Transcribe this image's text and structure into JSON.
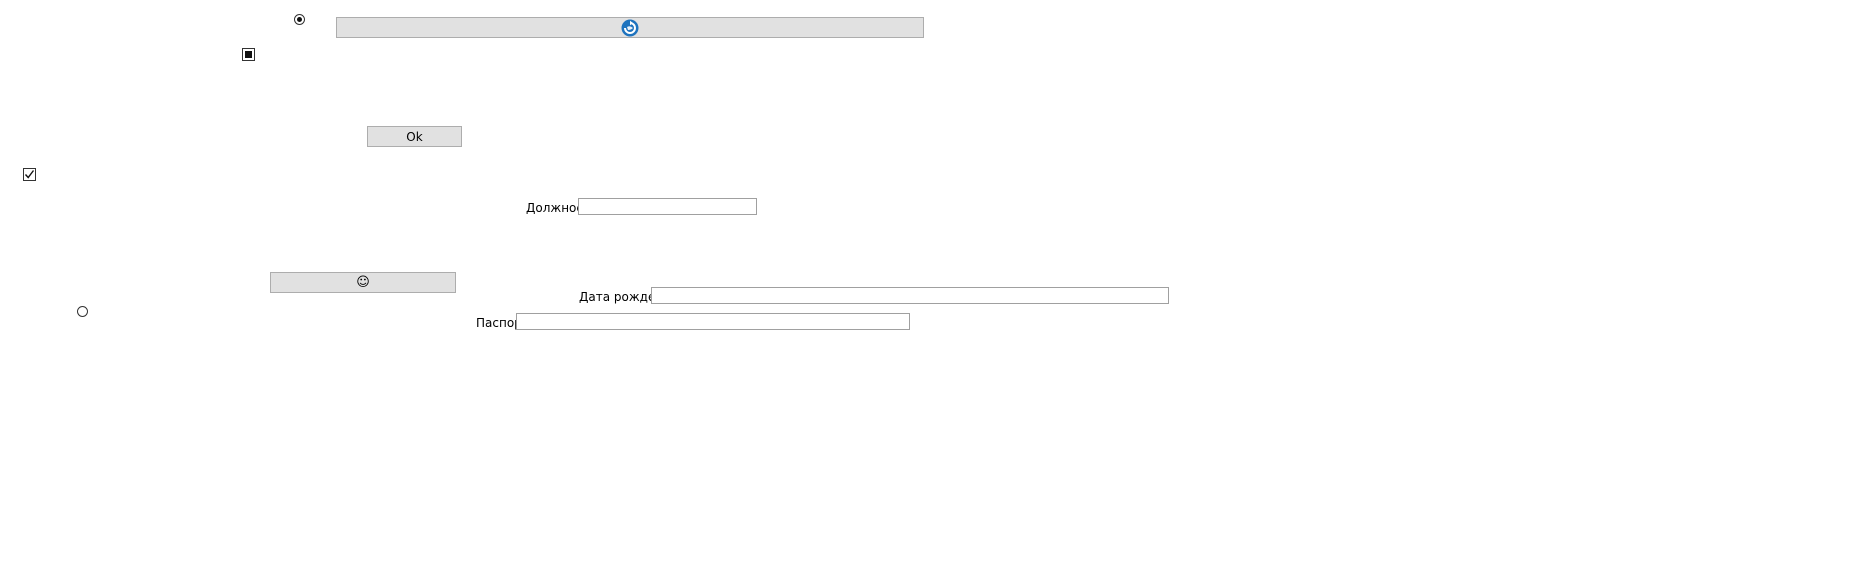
{
  "buttons": {
    "top_wide_icon": "refresh-globe-icon",
    "ok_label": "Ok",
    "smiley_icon": "smiley-icon",
    "smiley_glyph": "☺"
  },
  "labels": {
    "position": "Должность",
    "birth_date": "Дата рождения",
    "passport": "Паспорт"
  },
  "fields": {
    "position_value": "",
    "birth_date_value": "",
    "passport_value": ""
  },
  "controls": {
    "radio_top_checked": true,
    "radio_bottom_checked": false,
    "checkbox_indeterminate": true,
    "checkbox_checked": true
  },
  "colors": {
    "accent_blue": "#1e73be"
  }
}
